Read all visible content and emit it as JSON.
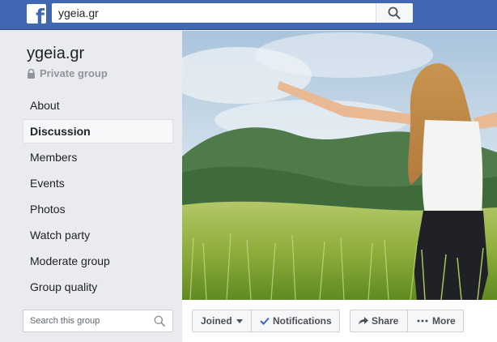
{
  "topbar": {
    "logo_letter": "f",
    "search_value": "ygeia.gr"
  },
  "group": {
    "name": "ygeia.gr",
    "privacy": "Private group"
  },
  "nav": {
    "items": [
      {
        "label": "About",
        "active": false
      },
      {
        "label": "Discussion",
        "active": true
      },
      {
        "label": "Members",
        "active": false
      },
      {
        "label": "Events",
        "active": false
      },
      {
        "label": "Photos",
        "active": false
      },
      {
        "label": "Watch party",
        "active": false
      },
      {
        "label": "Moderate group",
        "active": false
      },
      {
        "label": "Group quality",
        "active": false
      }
    ]
  },
  "group_search": {
    "placeholder": "Search this group"
  },
  "actions": {
    "joined": "Joined",
    "notifications": "Notifications",
    "share": "Share",
    "more": "More"
  },
  "colors": {
    "brand_blue": "#4267b2",
    "sidebar_bg": "#e9ebee",
    "check_blue": "#4267b2"
  }
}
